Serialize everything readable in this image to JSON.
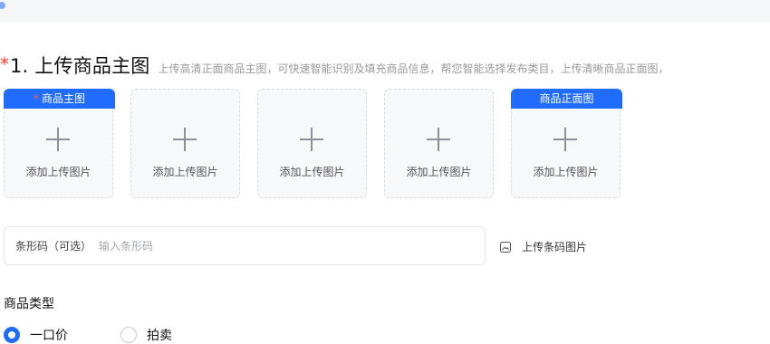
{
  "section": {
    "required_mark": "*",
    "title": "1. 上传商品主图",
    "hint": "上传高清正面商品主图，可快速智能识别及填充商品信息，帮您智能选择发布类目，上传清晰商品正面图，"
  },
  "uploads": [
    {
      "tag": "商品主图",
      "required": true,
      "label": "添加上传图片"
    },
    {
      "tag": "",
      "required": false,
      "label": "添加上传图片"
    },
    {
      "tag": "",
      "required": false,
      "label": "添加上传图片"
    },
    {
      "tag": "",
      "required": false,
      "label": "添加上传图片"
    },
    {
      "tag": "商品正面图",
      "required": false,
      "label": "添加上传图片"
    }
  ],
  "barcode": {
    "label": "条形码（可选）",
    "placeholder": "输入条形码",
    "upload_label": "上传条码图片",
    "upload_icon": "image-icon"
  },
  "product_type": {
    "label": "商品类型",
    "options": [
      {
        "label": "一口价",
        "selected": true
      },
      {
        "label": "拍卖",
        "selected": false
      }
    ]
  },
  "colors": {
    "accent": "#1f6cff",
    "required": "#ff3b30",
    "hint_text": "#999999",
    "card_bg": "#f7f8fa"
  }
}
